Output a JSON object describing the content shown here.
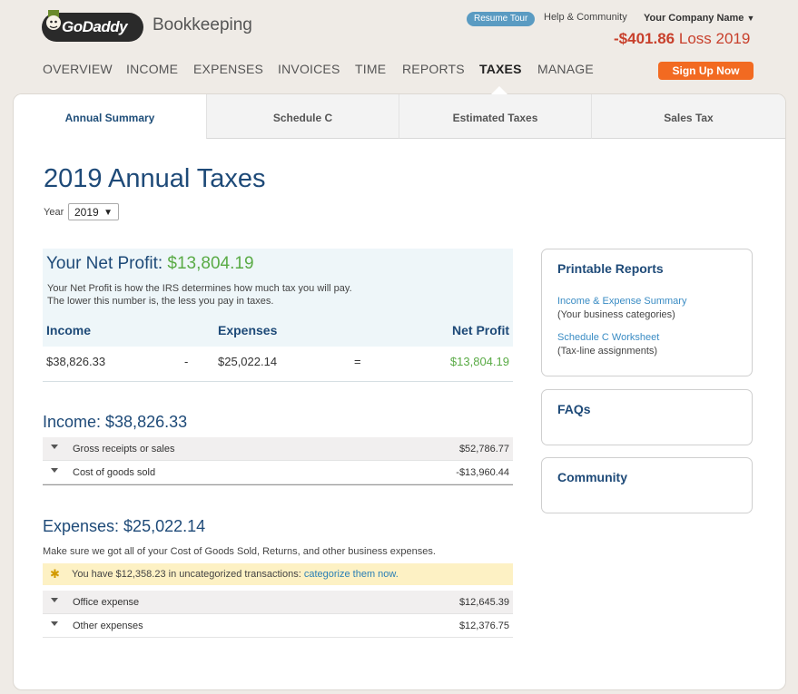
{
  "header": {
    "logo_text": "GoDaddy",
    "product_name": "Bookkeeping",
    "resume_tour": "Resume Tour",
    "help": "Help & Community",
    "company_name": "Your Company Name",
    "loss_amount": "-$401.86",
    "loss_label": "Loss 2019",
    "signup": "Sign Up Now"
  },
  "nav": {
    "items": [
      "OVERVIEW",
      "INCOME",
      "EXPENSES",
      "INVOICES",
      "TIME",
      "REPORTS",
      "TAXES",
      "MANAGE"
    ],
    "active": "TAXES"
  },
  "tabs": [
    "Annual Summary",
    "Schedule C",
    "Estimated Taxes",
    "Sales Tax"
  ],
  "page": {
    "title": "2019 Annual Taxes",
    "year_label": "Year",
    "year_value": "2019"
  },
  "net_profit": {
    "title": "Your Net Profit:",
    "value": "$13,804.19",
    "desc1": "Your Net Profit is how the IRS determines how much tax you will pay.",
    "desc2": "The lower this number is, the less you pay in taxes.",
    "h_income": "Income",
    "h_expenses": "Expenses",
    "h_net": "Net Profit",
    "income": "$38,826.33",
    "minus": "-",
    "expenses": "$25,022.14",
    "equals": "=",
    "net": "$13,804.19"
  },
  "income": {
    "title": "Income: $38,826.33",
    "rows": [
      {
        "label": "Gross receipts or sales",
        "amount": "$52,786.77"
      },
      {
        "label": "Cost of goods sold",
        "amount": "-$13,960.44"
      }
    ]
  },
  "expenses": {
    "title": "Expenses: $25,022.14",
    "note": "Make sure we got all of your Cost of Goods Sold, Returns, and other business expenses.",
    "alert_text": "You have $12,358.23 in uncategorized transactions:",
    "alert_link": "categorize them now.",
    "rows": [
      {
        "label": "Office expense",
        "amount": "$12,645.39"
      },
      {
        "label": "Other expenses",
        "amount": "$12,376.75"
      }
    ]
  },
  "side": {
    "reports_title": "Printable Reports",
    "link1": "Income & Expense Summary",
    "sub1": "(Your business categories)",
    "link2": "Schedule C Worksheet",
    "sub2": "(Tax-line assignments)",
    "faqs": "FAQs",
    "community": "Community"
  },
  "colors": {
    "accent_blue": "#1e4a78",
    "profit_green": "#5aab46",
    "loss_red": "#c8402c",
    "signup_orange": "#f26a21"
  }
}
